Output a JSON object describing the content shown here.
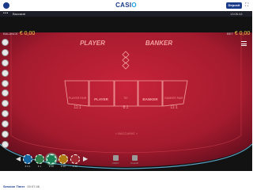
{
  "topbar": {
    "logo_main": "CASI",
    "logo_accent": "O",
    "deposit_label": "Deposit",
    "expand_icon": "expand-icon"
  },
  "gamebar": {
    "dots": "•••",
    "title": "Baccarat",
    "time": "13:06:44"
  },
  "game": {
    "balance_label": "BALANCE",
    "balance_value": "€ 0,00",
    "bet_label": "BET",
    "bet_value": "€ 0,00",
    "player_label": "PLAYER",
    "banker_label": "BANKER",
    "bet_areas": [
      {
        "title": "PLAYER PAIR",
        "payout": "11:1"
      },
      {
        "title": "PLAYER",
        "payout": ""
      },
      {
        "title": "TIE",
        "payout": "8:1"
      },
      {
        "title": "BANKER",
        "payout": ""
      },
      {
        "title": "BANKER PAIR",
        "payout": "11:1"
      }
    ],
    "table_name": "< BACCARAT >",
    "chips": [
      {
        "label": "€ 0.1",
        "color": "#1565a0"
      },
      {
        "label": "€ 1",
        "color": "#2e7d4a"
      },
      {
        "label": "€ 10",
        "color": "#1b7f56"
      },
      {
        "label": "€ 20",
        "color": "#b07a14"
      },
      {
        "label": "€ 50",
        "color": "#a02830"
      }
    ],
    "controls": [
      {
        "label": "UNDO"
      },
      {
        "label": "CLEAR"
      }
    ],
    "brand": "777"
  },
  "bottombar": {
    "session_label": "Session Timer",
    "session_value": "00:07:46"
  }
}
